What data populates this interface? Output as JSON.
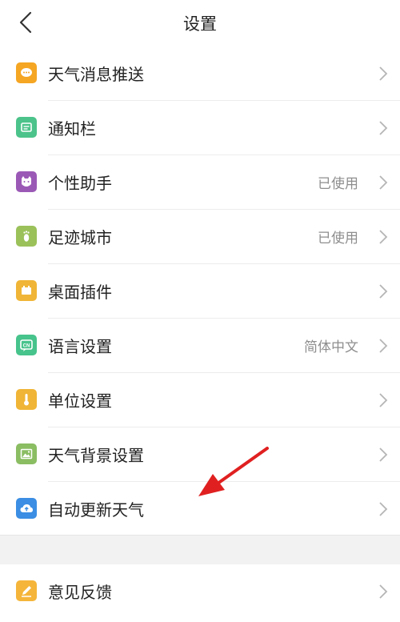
{
  "header": {
    "title": "设置",
    "back_icon": "chevron-left-icon"
  },
  "settings": [
    {
      "label": "天气消息推送",
      "value": "",
      "icon": "message-icon",
      "color": "#f5a623"
    },
    {
      "label": "通知栏",
      "value": "",
      "icon": "notification-bar-icon",
      "color": "#4cc38a"
    },
    {
      "label": "个性助手",
      "value": "已使用",
      "icon": "assistant-face-icon",
      "color": "#9b59b6"
    },
    {
      "label": "足迹城市",
      "value": "已使用",
      "icon": "footprint-icon",
      "color": "#9bc15a"
    },
    {
      "label": "桌面插件",
      "value": "",
      "icon": "widget-icon",
      "color": "#f0b536"
    },
    {
      "label": "语言设置",
      "value": "简体中文",
      "icon": "language-cn-icon",
      "color": "#47c38c"
    },
    {
      "label": "单位设置",
      "value": "",
      "icon": "thermometer-icon",
      "color": "#f0b536"
    },
    {
      "label": "天气背景设置",
      "value": "",
      "icon": "image-icon",
      "color": "#8bbd63"
    },
    {
      "label": "自动更新天气",
      "value": "",
      "icon": "cloud-upload-icon",
      "color": "#3b8ee3"
    }
  ],
  "settings2": [
    {
      "label": "意见反馈",
      "value": "",
      "icon": "feedback-edit-icon",
      "color": "#f5b53a"
    }
  ],
  "annotation": {
    "type": "red-arrow",
    "color": "#e02020"
  }
}
